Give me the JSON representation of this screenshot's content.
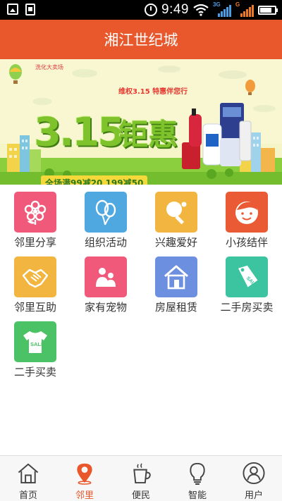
{
  "status_bar": {
    "time": "9:49",
    "network_1": "3G",
    "network_2": "G",
    "icons": [
      "image-icon",
      "document-icon",
      "alarm-icon",
      "wifi-icon",
      "signal-icon",
      "battery-icon"
    ]
  },
  "header": {
    "title": "湘江世纪城"
  },
  "banner": {
    "tag": "洗化大卖场",
    "caption": "维权3.15 特惠伴您行",
    "big_number": "3.15",
    "big_word": "钜惠",
    "deal": "全场满99减20 199减50"
  },
  "grid": {
    "items": [
      {
        "label": "邻里分享",
        "icon": "flower-icon",
        "color": "#f0597a"
      },
      {
        "label": "组织活动",
        "icon": "balloon-icon",
        "color": "#4fa8e0"
      },
      {
        "label": "兴趣爱好",
        "icon": "ping-pong-icon",
        "color": "#f2b53f"
      },
      {
        "label": "小孩结伴",
        "icon": "child-face-icon",
        "color": "#ea5a35"
      },
      {
        "label": "邻里互助",
        "icon": "handshake-icon",
        "color": "#f2b53f"
      },
      {
        "label": "家有宠物",
        "icon": "pet-icon",
        "color": "#f0597a"
      },
      {
        "label": "房屋租赁",
        "icon": "house-icon",
        "color": "#6d8fe0"
      },
      {
        "label": "二手房买卖",
        "icon": "sale-tag-icon",
        "color": "#3cc4a0"
      },
      {
        "label": "二手买卖",
        "icon": "tshirt-icon",
        "color": "#4cc267"
      }
    ]
  },
  "bottom_nav": {
    "items": [
      {
        "label": "首页",
        "icon": "home-icon"
      },
      {
        "label": "邻里",
        "icon": "location-pin-icon",
        "active": true
      },
      {
        "label": "便民",
        "icon": "coffee-cup-icon"
      },
      {
        "label": "智能",
        "icon": "lightbulb-icon"
      },
      {
        "label": "用户",
        "icon": "user-icon"
      }
    ],
    "active_color": "#e8582c"
  }
}
